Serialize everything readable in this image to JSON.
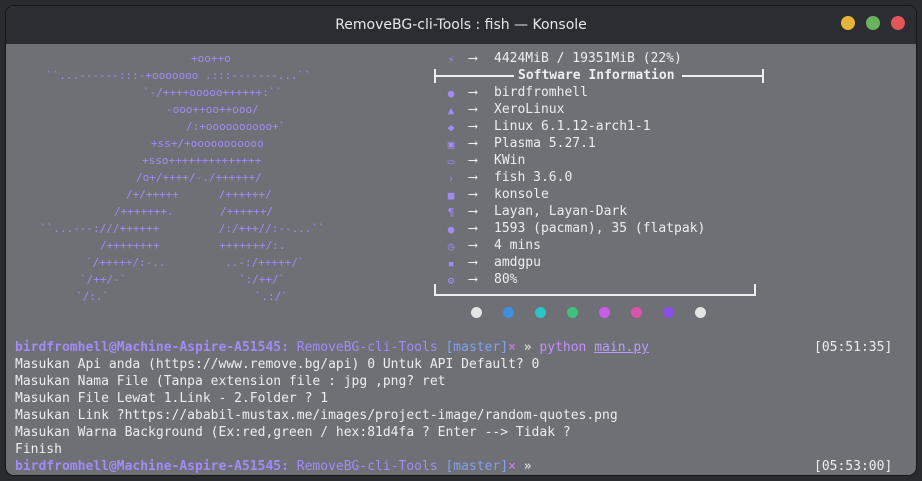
{
  "window": {
    "title": "RemoveBG-cli-Tools : fish — Konsole"
  },
  "neofetch": {
    "art_lines": [
      "+oo++o",
      "``...------:::-+ooooooo .:::-------...``",
      "`-/++++ooooo++++++:``",
      "-ooo++oo++ooo/",
      "/:+oooooooooo+`",
      "+ss+/+ooooooooooo",
      "+sso++++++++++++++",
      "/o+/++++/-./++++++/",
      "/+/+++++      /++++++/",
      "/+++++++.       /++++++/",
      "``...---:///++++++         /:/+++//:--...``",
      "/++++++++         +++++++/:.",
      "`/+++++/:-..         ..-:/+++++/`",
      "`/++/-`                 `:/++/`",
      "`/:.`                      `.:/`"
    ],
    "memory_row": {
      "icon": "memory-icon",
      "value": "4424MiB / 19351MiB (22%)"
    },
    "section_title": "Software Information",
    "rows": [
      {
        "icon": "user-icon",
        "value": "birdfromhell"
      },
      {
        "icon": "distro-icon",
        "value": "XeroLinux"
      },
      {
        "icon": "kernel-icon",
        "value": "Linux 6.1.12-arch1-1"
      },
      {
        "icon": "desktop-icon",
        "value": "Plasma 5.27.1"
      },
      {
        "icon": "window-manager-icon",
        "value": "KWin"
      },
      {
        "icon": "shell-icon",
        "value": "fish 3.6.0"
      },
      {
        "icon": "terminal-icon",
        "value": "konsole"
      },
      {
        "icon": "theme-icon",
        "value": "Layan, Layan-Dark"
      },
      {
        "icon": "package-icon",
        "value": "1593 (pacman), 35 (flatpak)"
      },
      {
        "icon": "uptime-icon",
        "value": "4 mins"
      },
      {
        "icon": "gpu-icon",
        "value": "amdgpu"
      },
      {
        "icon": "battery-icon",
        "value": "80%"
      }
    ],
    "arrow": "⟶",
    "palette": [
      "#e4e4e4",
      "#3d8fe0",
      "#2bc4c4",
      "#3ec47a",
      "#c95ce8",
      "#d955a9",
      "#8a4ee6",
      "#e4e4e4"
    ]
  },
  "session": {
    "prompt1": {
      "user": "birdfromhell@Machine-Aspire-A51545:",
      "dir": "RemoveBG-cli-Tools",
      "branch": "[master]",
      "dirty": "×",
      "sep": "»",
      "cmd": "python",
      "arg": "main.py",
      "time": "[05:51:35]"
    },
    "output": [
      "Masukan Api anda (https://www.remove.bg/api) 0 Untuk API Default? 0",
      "Masukan Nama File (Tanpa extension file : jpg ,png? ret",
      "Masukan File Lewat 1.Link - 2.Folder ? 1",
      "Masukan Link ?https://ababil-mustax.me/images/project-image/random-quotes.png",
      "Masukan Warna Background (Ex:red,green / hex:81d4fa ? Enter --> Tidak ?",
      "Finish"
    ],
    "prompt2": {
      "user": "birdfromhell@Machine-Aspire-A51545:",
      "dir": "RemoveBG-cli-Tools",
      "branch": "[master]",
      "dirty": "×",
      "sep": "»",
      "time": "[05:53:00]"
    }
  }
}
